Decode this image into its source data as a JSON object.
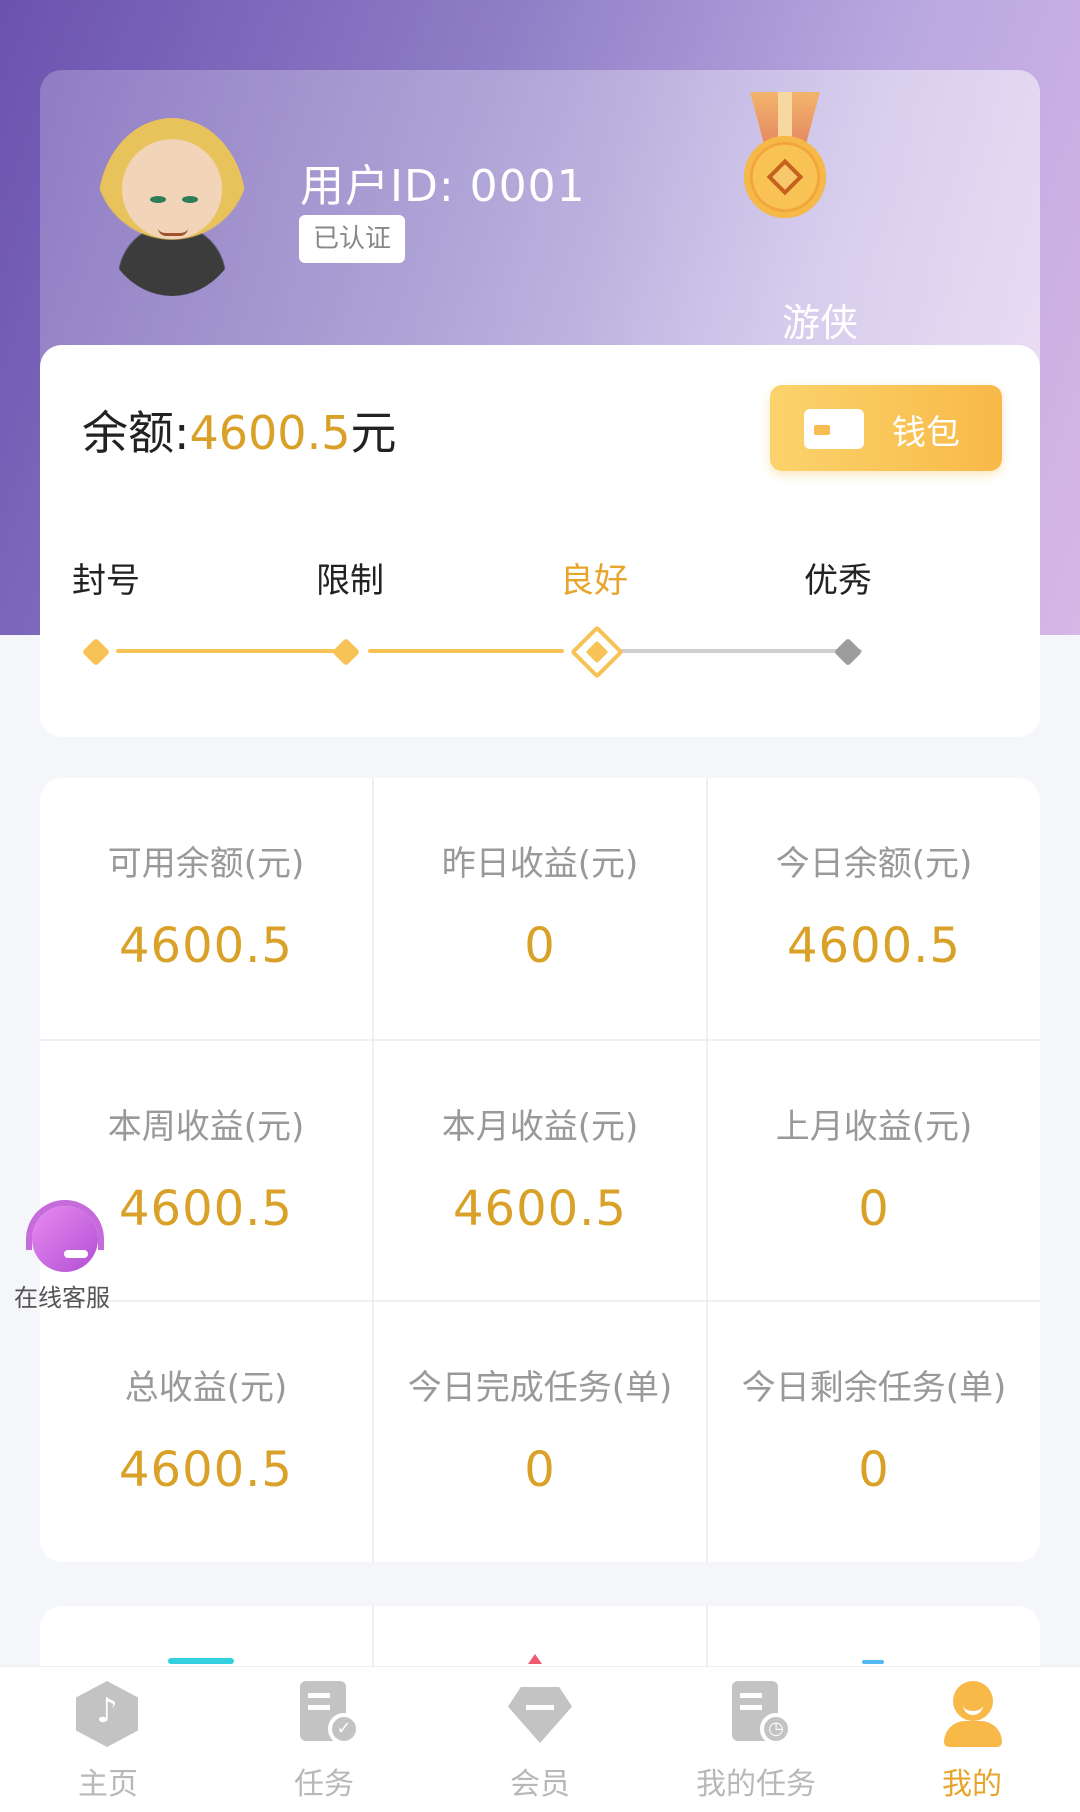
{
  "profile": {
    "user_id_label": "用户ID: 0001",
    "verified_badge": "已认证",
    "rank_label": "游侠"
  },
  "balance": {
    "label": "余额:",
    "amount": "4600.5",
    "unit": "元",
    "wallet_button": "钱包"
  },
  "account_status": {
    "levels": [
      "封号",
      "限制",
      "良好",
      "优秀"
    ],
    "current_level": "良好",
    "current_index": 2
  },
  "stats": [
    {
      "label": "可用余额(元)",
      "value": "4600.5"
    },
    {
      "label": "昨日收益(元)",
      "value": "0"
    },
    {
      "label": "今日余额(元)",
      "value": "4600.5"
    },
    {
      "label": "本周收益(元)",
      "value": "4600.5"
    },
    {
      "label": "本月收益(元)",
      "value": "4600.5"
    },
    {
      "label": "上月收益(元)",
      "value": "0"
    },
    {
      "label": "总收益(元)",
      "value": "4600.5"
    },
    {
      "label": "今日完成任务(单)",
      "value": "0"
    },
    {
      "label": "今日剩余任务(单)",
      "value": "0"
    }
  ],
  "customer_service": {
    "label": "在线客服"
  },
  "tabbar": {
    "items": [
      {
        "label": "主页",
        "icon": "tiktok-hex-icon"
      },
      {
        "label": "任务",
        "icon": "task-doc-check-icon"
      },
      {
        "label": "会员",
        "icon": "diamond-icon"
      },
      {
        "label": "我的任务",
        "icon": "task-doc-clock-icon"
      },
      {
        "label": "我的",
        "icon": "person-icon"
      }
    ],
    "active_index": 4
  },
  "colors": {
    "accent": "#e8a52d",
    "value_gold": "#d9a127",
    "hero_gradient_start": "#6b52b0",
    "hero_gradient_end": "#d8b6e6",
    "inactive_gray": "#b8b8b8"
  }
}
